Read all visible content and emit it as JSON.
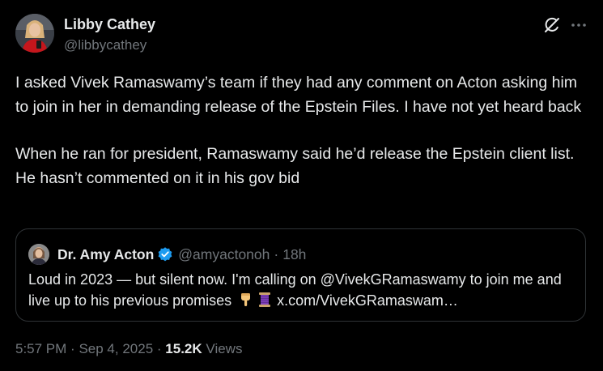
{
  "author": {
    "name": "Libby Cathey",
    "handle": "@libbycathey"
  },
  "icons": {
    "grok": "grok-icon",
    "more": "more-icon",
    "verified": "verified-badge-icon"
  },
  "colors": {
    "background": "#000000",
    "primary_text": "#e7e9ea",
    "secondary_text": "#71767b",
    "border": "#2f3336",
    "verified_blue": "#1d9bf0"
  },
  "tweet": {
    "paragraphs": [
      "I asked Vivek Ramaswamy’s team if they had any comment on Acton asking him to join in her in demanding release of the Epstein Files. I have not yet heard back",
      "When he ran for president, Ramaswamy said he’d release the Epstein client list. He hasn’t commented on it in his gov bid"
    ]
  },
  "quote": {
    "name": "Dr. Amy Acton",
    "handle": "@amyactonoh",
    "separator": "·",
    "time": "18h",
    "text_start": "Loud in 2023 — but silent now. I'm calling on @VivekGRamaswamy to join me and live up to his previous promises",
    "emojis": [
      "pointing-down-hand",
      "spool-of-thread"
    ],
    "link": "x.com/VivekGRamaswam…"
  },
  "meta": {
    "time": "5:57 PM",
    "separator": "·",
    "date": "Sep 4, 2025",
    "views_count": "15.2K",
    "views_label": "Views"
  }
}
